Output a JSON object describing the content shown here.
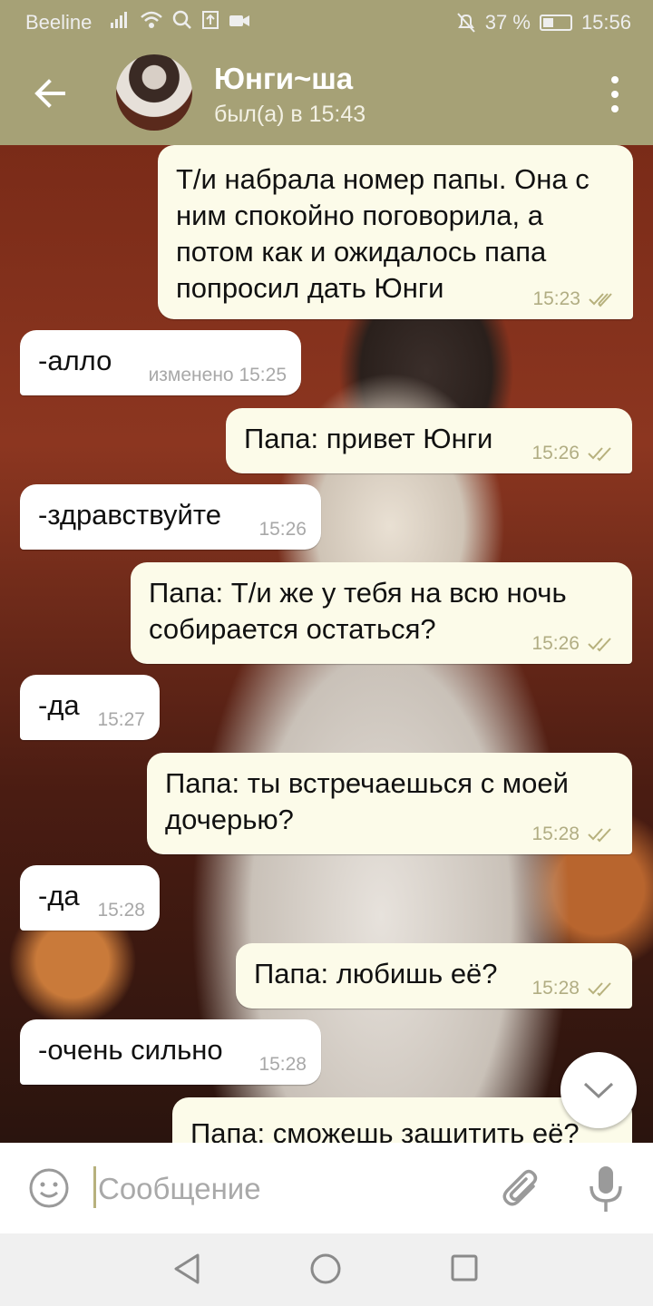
{
  "status_bar": {
    "carrier": "Beeline",
    "battery": "37 %",
    "time": "15:56",
    "icons": [
      "signal-icon",
      "wifi-icon",
      "search-icon",
      "upload-icon",
      "video-icon",
      "mute-icon",
      "battery-icon"
    ]
  },
  "header": {
    "name": "Юнги~ша",
    "last_seen": "был(а) в 15:43"
  },
  "messages": [
    {
      "side": "out",
      "text": "Т/и набрала номер папы. Она с ним спокойно поговорила, а потом как и ожидалось папа попросил дать Юнги",
      "time": "15:23",
      "read": true
    },
    {
      "side": "in",
      "text": "-алло",
      "time": "изменено 15:25"
    },
    {
      "side": "out",
      "text": "Папа: привет Юнги",
      "time": "15:26",
      "read": true
    },
    {
      "side": "in",
      "text": "-здравствуйте",
      "time": "15:26"
    },
    {
      "side": "out",
      "text": "Папа: Т/и же у тебя на всю ночь собирается остаться?",
      "time": "15:26",
      "read": true
    },
    {
      "side": "in",
      "text": "-да",
      "time": "15:27"
    },
    {
      "side": "out",
      "text": "Папа: ты встречаешься с моей дочерью?",
      "time": "15:28",
      "read": true
    },
    {
      "side": "in",
      "text": "-да",
      "time": "15:28"
    },
    {
      "side": "out",
      "text": "Папа: любишь её?",
      "time": "15:28",
      "read": true
    },
    {
      "side": "in",
      "text": "-очень сильно",
      "time": "15:28"
    },
    {
      "side": "out",
      "text": "Папа: сможешь защитить её?",
      "time": "",
      "read": false
    }
  ],
  "input": {
    "placeholder": "Сообщение"
  },
  "colors": {
    "header": "#a6a176",
    "outgoing_bubble": "#fcfbe9",
    "incoming_bubble": "#ffffff",
    "read_ticks": "#b7b17d"
  }
}
